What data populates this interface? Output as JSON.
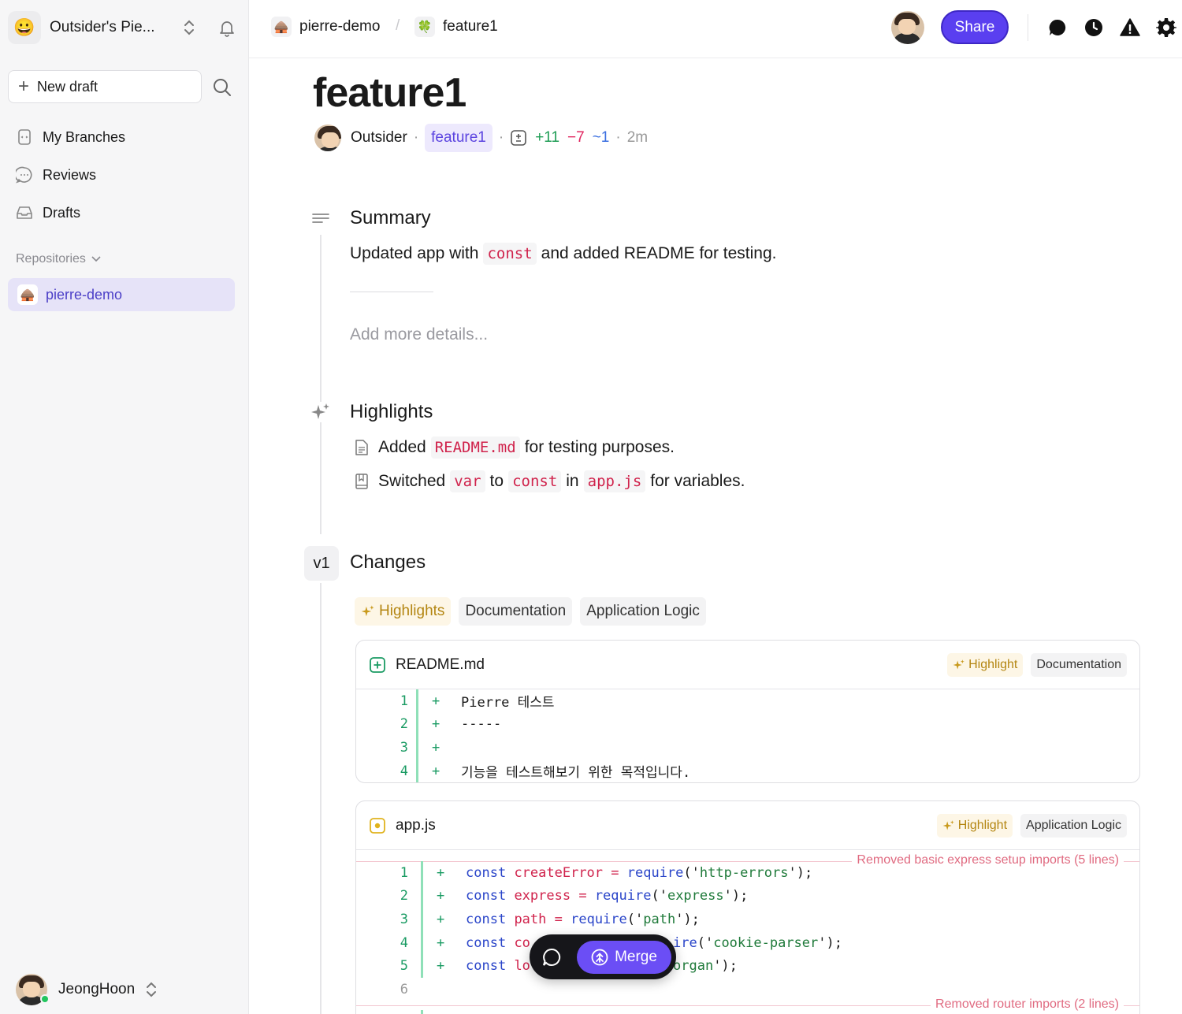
{
  "sidebar": {
    "workspace_emoji": "😀",
    "workspace_name": "Outsider's Pie...",
    "new_draft_label": "New draft",
    "nav": [
      {
        "label": "My Branches"
      },
      {
        "label": "Reviews"
      },
      {
        "label": "Drafts"
      }
    ],
    "repositories_label": "Repositories",
    "repos": [
      {
        "label": "pierre-demo",
        "emoji": "🛖"
      }
    ],
    "user_name": "JeongHoon"
  },
  "topbar": {
    "repo_crumb": "pierre-demo",
    "repo_emoji": "🛖",
    "branch_crumb": "feature1",
    "branch_emoji": "🍀",
    "crumb_separator": "/",
    "share_label": "Share"
  },
  "page": {
    "title": "feature1",
    "author": "Outsider",
    "branch": "feature1",
    "additions": "+11",
    "deletions": "−7",
    "modifications": "~1",
    "age": "2m",
    "dot": "·"
  },
  "summary": {
    "heading": "Summary",
    "text_before": "Updated app with",
    "code": "const",
    "text_after": "and added README for testing.",
    "details_placeholder": "Add more details..."
  },
  "highlights": {
    "heading": "Highlights",
    "item1": {
      "before": "Added",
      "code": "README.md",
      "after": "for testing purposes."
    },
    "item2": {
      "w1": "Switched",
      "c1": "var",
      "w2": "to",
      "c2": "const",
      "w3": "in",
      "c3": "app.js",
      "w4": "for variables."
    }
  },
  "changes": {
    "version": "v1",
    "heading": "Changes",
    "filters": [
      "Highlights",
      "Documentation",
      "Application Logic"
    ],
    "files": [
      {
        "name": "README.md",
        "tags": [
          "Highlight",
          "Documentation"
        ],
        "lines": [
          {
            "n": "1",
            "sign": "+",
            "text": "Pierre 테스트"
          },
          {
            "n": "2",
            "sign": "+",
            "text": "-----"
          },
          {
            "n": "3",
            "sign": "+",
            "text": ""
          },
          {
            "n": "4",
            "sign": "+",
            "text": "기능을 테스트해보기 위한 목적입니다."
          }
        ]
      },
      {
        "name": "app.js",
        "tags": [
          "Highlight",
          "Application Logic"
        ],
        "notes": [
          "Removed basic express setup imports (5 lines)",
          "Removed router imports (2 lines)"
        ],
        "lines": [
          {
            "n": "1",
            "sign": "+",
            "kw": "const",
            "name": "createError",
            "op": " = ",
            "fn": "require",
            "p1": "('",
            "str": "http-errors",
            "p2": "');"
          },
          {
            "n": "2",
            "sign": "+",
            "kw": "const",
            "name": "express",
            "op": " = ",
            "fn": "require",
            "p1": "('",
            "str": "express",
            "p2": "');"
          },
          {
            "n": "3",
            "sign": "+",
            "kw": "const",
            "name": "path",
            "op": " = ",
            "fn": "require",
            "p1": "('",
            "str": "path",
            "p2": "');"
          },
          {
            "n": "4",
            "sign": "+",
            "kw": "const",
            "name": "co",
            "op": "",
            "fn": "",
            "p1": "",
            "str": "",
            "p2": "",
            "tail_fn": "ire",
            "tail_p1": "('",
            "tail_str": "cookie-parser",
            "tail_p2": "');"
          },
          {
            "n": "5",
            "sign": "+",
            "kw": "const",
            "name": "lo",
            "op": "",
            "fn": "",
            "p1": "",
            "str": "",
            "p2": "",
            "tail_str2": "organ",
            "tail_p3": "');"
          },
          {
            "n": "6",
            "sign": "",
            "text": ""
          }
        ]
      }
    ]
  },
  "merge": {
    "label": "Merge"
  },
  "colors": {
    "accent": "#5a3ff0",
    "add": "#1a9b63",
    "del": "#e0245e",
    "mod": "#3a6fe0",
    "highlight": "#b48612"
  }
}
